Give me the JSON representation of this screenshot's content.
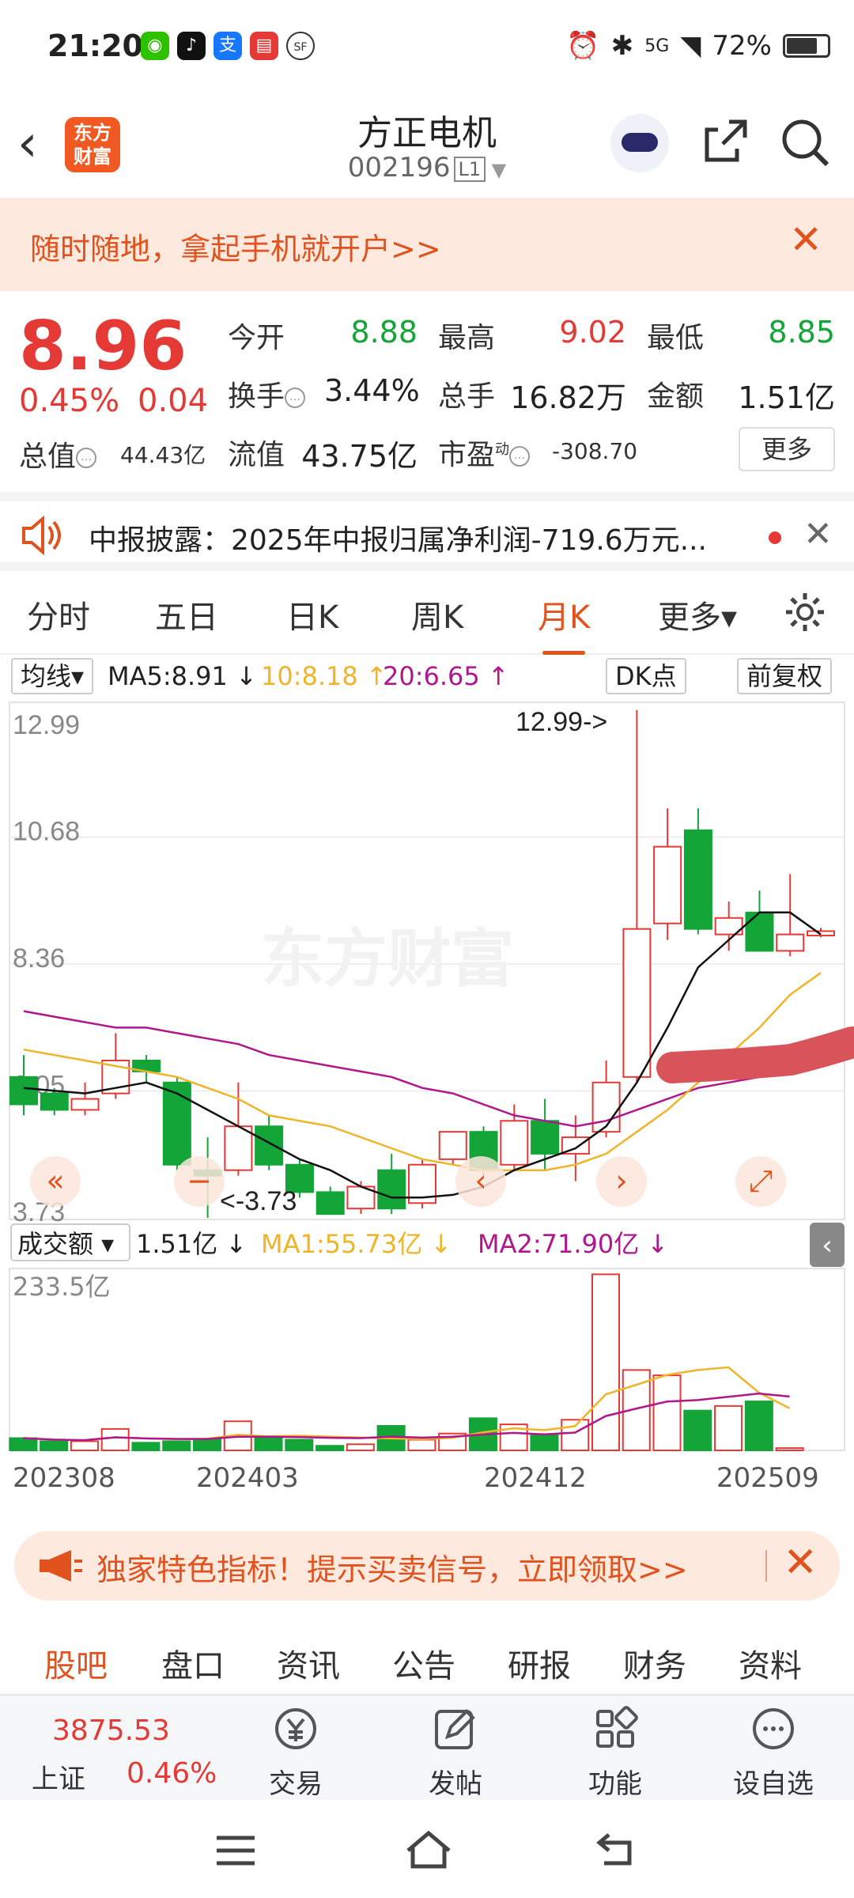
{
  "status_bar": {
    "time": "21:20",
    "battery": "72%",
    "network": "5G"
  },
  "header": {
    "logo_text": "东方\n财富",
    "stock_name": "方正电机",
    "stock_code": "002196",
    "level": "L1"
  },
  "banner": {
    "text": "随时随地，拿起手机就开户>>"
  },
  "quote": {
    "price": "8.96",
    "change_pct": "0.45%",
    "change": "0.04",
    "open_label": "今开",
    "open": "8.88",
    "high_label": "最高",
    "high": "9.02",
    "low_label": "最低",
    "low": "8.85",
    "turnover_label": "换手",
    "turnover": "3.44%",
    "volume_label": "总手",
    "volume": "16.82万",
    "amount_label": "金额",
    "amount": "1.51亿",
    "mktcap_label": "总值",
    "mktcap": "44.43亿",
    "float_label": "流值",
    "float": "43.75亿",
    "pe_label": "市盈",
    "pe_sup": "动",
    "pe": "-308.70",
    "more": "更多"
  },
  "notice": {
    "text": "中报披露：2025年中报归属净利润-719.6万元..."
  },
  "tabs": [
    "分时",
    "五日",
    "日K",
    "周K",
    "月K",
    "更多▾"
  ],
  "active_tab": 4,
  "kline_bar": {
    "ma_select": "均线▾",
    "ma5": "MA5:8.91 ↓",
    "ma10": "10:8.18 ↑",
    "ma20": "20:6.65 ↑",
    "dk": "DK点",
    "adjust": "前复权"
  },
  "colors": {
    "up": "#e53935",
    "down": "#13a537",
    "accent": "#e0521e",
    "ma5": "#111111",
    "ma10": "#f0b428",
    "ma20": "#b0178c"
  },
  "chart_data": {
    "type": "candlestick",
    "price_axis": {
      "max": 12.99,
      "min": 3.73,
      "ticks": [
        "12.99",
        "10.68",
        "8.36",
        "6.05",
        "3.73"
      ]
    },
    "max_label": "12.99->",
    "min_label": "<-3.73",
    "watermark": "东方财富",
    "candles": [
      {
        "o": 6.3,
        "c": 5.8,
        "h": 6.7,
        "l": 5.6
      },
      {
        "o": 6.0,
        "c": 5.7,
        "h": 6.1,
        "l": 5.6
      },
      {
        "o": 5.7,
        "c": 5.9,
        "h": 6.2,
        "l": 5.6
      },
      {
        "o": 6.0,
        "c": 6.6,
        "h": 7.1,
        "l": 5.9
      },
      {
        "o": 6.6,
        "c": 6.4,
        "h": 6.7,
        "l": 6.2
      },
      {
        "o": 6.2,
        "c": 4.7,
        "h": 6.3,
        "l": 4.6
      },
      {
        "o": 4.6,
        "c": 4.5,
        "h": 5.2,
        "l": 3.73
      },
      {
        "o": 4.6,
        "c": 5.4,
        "h": 6.2,
        "l": 4.5
      },
      {
        "o": 5.4,
        "c": 4.7,
        "h": 5.6,
        "l": 4.6
      },
      {
        "o": 4.7,
        "c": 4.2,
        "h": 4.8,
        "l": 4.1
      },
      {
        "o": 4.2,
        "c": 3.8,
        "h": 4.3,
        "l": 3.8
      },
      {
        "o": 3.9,
        "c": 4.3,
        "h": 4.4,
        "l": 3.8
      },
      {
        "o": 4.6,
        "c": 3.9,
        "h": 4.9,
        "l": 3.8
      },
      {
        "o": 4.0,
        "c": 4.7,
        "h": 4.8,
        "l": 3.9
      },
      {
        "o": 4.8,
        "c": 5.3,
        "h": 5.3,
        "l": 4.7
      },
      {
        "o": 5.3,
        "c": 4.6,
        "h": 5.4,
        "l": 4.5
      },
      {
        "o": 4.7,
        "c": 5.5,
        "h": 5.8,
        "l": 4.6
      },
      {
        "o": 5.5,
        "c": 4.9,
        "h": 5.9,
        "l": 4.6
      },
      {
        "o": 4.9,
        "c": 5.2,
        "h": 5.6,
        "l": 4.4
      },
      {
        "o": 5.3,
        "c": 6.2,
        "h": 6.6,
        "l": 5.2
      },
      {
        "o": 6.3,
        "c": 9.0,
        "h": 12.99,
        "l": 6.2
      },
      {
        "o": 9.1,
        "c": 10.5,
        "h": 11.2,
        "l": 8.8
      },
      {
        "o": 10.8,
        "c": 9.0,
        "h": 11.2,
        "l": 8.9
      },
      {
        "o": 8.9,
        "c": 9.2,
        "h": 9.5,
        "l": 8.6
      },
      {
        "o": 9.3,
        "c": 8.6,
        "h": 9.7,
        "l": 8.6
      },
      {
        "o": 8.6,
        "c": 8.9,
        "h": 10.0,
        "l": 8.5
      },
      {
        "o": 8.88,
        "c": 8.96,
        "h": 9.02,
        "l": 8.85
      }
    ],
    "ma5": [
      6.1,
      6.05,
      6.0,
      6.1,
      6.2,
      6.0,
      5.7,
      5.4,
      5.1,
      4.8,
      4.6,
      4.3,
      4.1,
      4.1,
      4.15,
      4.3,
      4.6,
      4.8,
      5.0,
      5.4,
      6.2,
      7.2,
      8.3,
      8.8,
      9.3,
      9.3,
      8.9
    ],
    "ma10": [
      6.8,
      6.7,
      6.6,
      6.5,
      6.4,
      6.3,
      6.1,
      5.9,
      5.6,
      5.5,
      5.4,
      5.2,
      5.0,
      4.8,
      4.7,
      4.6,
      4.6,
      4.6,
      4.7,
      4.9,
      5.3,
      5.7,
      6.2,
      6.7,
      7.2,
      7.8,
      8.2
    ],
    "ma20": [
      7.5,
      7.4,
      7.3,
      7.2,
      7.2,
      7.1,
      7.0,
      6.9,
      6.7,
      6.6,
      6.5,
      6.4,
      6.3,
      6.1,
      6.0,
      5.8,
      5.6,
      5.5,
      5.4,
      5.5,
      5.7,
      5.9,
      6.1,
      6.2,
      6.3,
      6.5,
      6.65
    ],
    "volume": {
      "label": "成交额",
      "current": "1.51亿 ↓",
      "ma1": "MA1:55.73亿 ↓",
      "ma2": "MA2:71.90亿 ↓",
      "max_label": "233.5亿",
      "max": 233.5,
      "values": [
        16,
        12,
        12,
        28,
        10,
        12,
        14,
        38,
        18,
        14,
        6,
        8,
        32,
        14,
        22,
        42,
        34,
        20,
        40,
        230,
        105,
        98,
        52,
        58,
        64,
        3
      ]
    },
    "x_labels": [
      "202308",
      "202403",
      "202412",
      "202509"
    ]
  },
  "promo": {
    "text": "独家特色指标！提示买卖信号，立即领取>>"
  },
  "bottom_tabs": [
    "股吧",
    "盘口",
    "资讯",
    "公告",
    "研报",
    "财务",
    "资料"
  ],
  "index": {
    "value": "3875.53",
    "name": "上证",
    "change": "0.46%"
  },
  "bottom_buttons": [
    {
      "label": "交易",
      "icon": "yen-icon"
    },
    {
      "label": "发帖",
      "icon": "edit-icon"
    },
    {
      "label": "功能",
      "icon": "grid-icon"
    },
    {
      "label": "设自选",
      "icon": "more-icon"
    }
  ]
}
